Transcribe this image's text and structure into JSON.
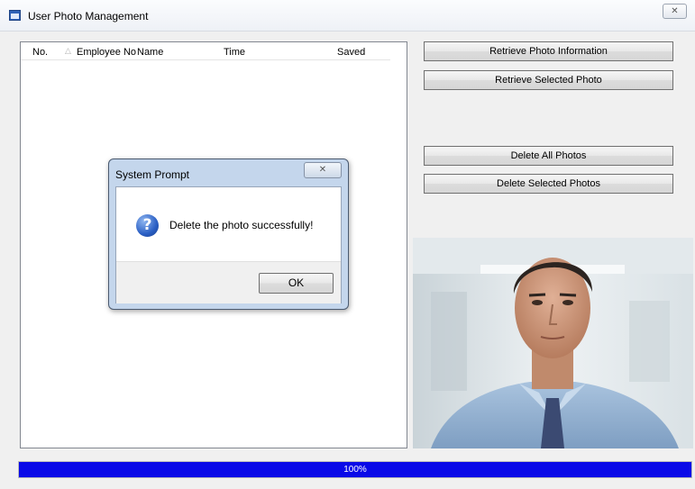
{
  "window": {
    "title": "User Photo Management",
    "close_glyph": "✕"
  },
  "list": {
    "columns": [
      "No.",
      "Employee No",
      "Name",
      "Time",
      "Saved"
    ],
    "sort_indicator": "△",
    "rows": []
  },
  "buttons": {
    "retrieve_info": "Retrieve Photo Information",
    "retrieve_selected": "Retrieve Selected Photo",
    "delete_all": "Delete All Photos",
    "delete_selected": "Delete Selected Photos"
  },
  "progress": {
    "value": 1.0,
    "label": "100%",
    "fill_color": "#0a0ae8"
  },
  "dialog": {
    "title": "System Prompt",
    "close_glyph": "✕",
    "icon": "question-icon",
    "icon_glyph": "?",
    "message": "Delete the photo successfully!",
    "ok_label": "OK"
  },
  "photo": {
    "subject": "employee-portrait"
  }
}
